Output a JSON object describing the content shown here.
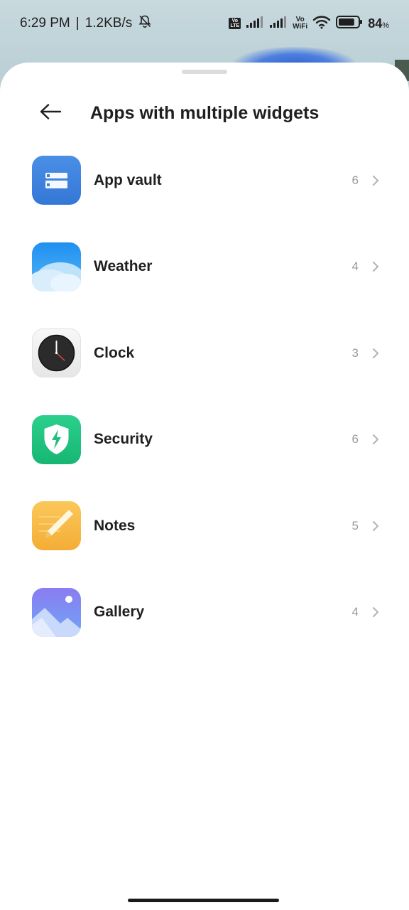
{
  "status_bar": {
    "time": "6:29 PM",
    "separator": "|",
    "speed": "1.2KB/s",
    "volte_tag_top": "Vo",
    "volte_tag_bottom": "LTE",
    "vowifi_top": "Vo",
    "vowifi_bottom": "WiFi",
    "battery_percent": "84",
    "battery_unit": "%",
    "battery_level": 0.84
  },
  "header": {
    "title": "Apps with multiple widgets",
    "back_icon": "arrow-left-icon"
  },
  "apps": [
    {
      "name": "App vault",
      "count": "6",
      "icon": "app-vault-icon",
      "color": "#3d82db"
    },
    {
      "name": "Weather",
      "count": "4",
      "icon": "weather-icon",
      "color": "#2b9ff0"
    },
    {
      "name": "Clock",
      "count": "3",
      "icon": "clock-icon",
      "color": "#f0f0f0"
    },
    {
      "name": "Security",
      "count": "6",
      "icon": "security-shield-icon",
      "color": "#1fbf7f"
    },
    {
      "name": "Notes",
      "count": "5",
      "icon": "notes-icon",
      "color": "#f7b843"
    },
    {
      "name": "Gallery",
      "count": "4",
      "icon": "gallery-icon",
      "color": "#7a8cf3"
    }
  ]
}
